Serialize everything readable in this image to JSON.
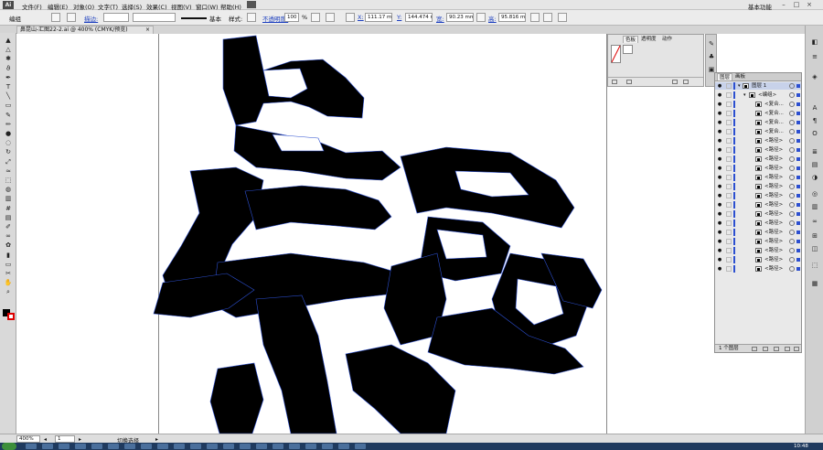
{
  "app": {
    "logo": "Ai",
    "menus": [
      "文件(F)",
      "编辑(E)",
      "对象(O)",
      "文字(T)",
      "选择(S)",
      "效果(C)",
      "视图(V)",
      "窗口(W)",
      "帮助(H)"
    ],
    "workspace": "基本功能",
    "window_buttons": [
      "–",
      "□",
      "×"
    ]
  },
  "control_bar": {
    "selection_label": "编组",
    "stroke_label": "描边:",
    "stroke_value": "",
    "brush_label": "基本",
    "style_label": "样式:",
    "opacity_label": "不透明度:",
    "opacity_value": "100",
    "opacity_unit": "%",
    "x_value": "111.17 mm",
    "y_value": "144.474 mm",
    "w_label": "宽:",
    "w_value": "90.23 mm",
    "h_label": "高:",
    "h_value": "95.816 mm"
  },
  "document": {
    "tab_title": "鼻昆山-汇图22-2.ai @ 400% (CMYK/预览)"
  },
  "tools": [
    "selection-tool",
    "direct-selection-tool",
    "magic-wand-tool",
    "lasso-tool",
    "pen-tool",
    "type-tool",
    "line-tool",
    "rectangle-tool",
    "paintbrush-tool",
    "pencil-tool",
    "blob-brush-tool",
    "eraser-tool",
    "rotate-tool",
    "scale-tool",
    "width-tool",
    "free-transform-tool",
    "shape-builder-tool",
    "perspective-grid-tool",
    "mesh-tool",
    "gradient-tool",
    "eyedropper-tool",
    "blend-tool",
    "symbol-sprayer-tool",
    "column-graph-tool",
    "artboard-tool",
    "slice-tool",
    "hand-tool",
    "zoom-tool"
  ],
  "color_panel": {
    "tabs": [
      "色板",
      "透明度",
      "动作"
    ],
    "active_tab": "色板"
  },
  "layers_panel": {
    "tabs": [
      "图层",
      "画板"
    ],
    "rows": [
      {
        "label": "图层 1",
        "level": 0
      },
      {
        "label": "<编组>",
        "level": 1
      },
      {
        "label": "<复合...",
        "level": 2
      },
      {
        "label": "<复合...",
        "level": 2
      },
      {
        "label": "<复合...",
        "level": 2
      },
      {
        "label": "<复合...",
        "level": 2
      },
      {
        "label": "<路径>",
        "level": 2
      },
      {
        "label": "<路径>",
        "level": 2
      },
      {
        "label": "<路径>",
        "level": 2
      },
      {
        "label": "<路径>",
        "level": 2
      },
      {
        "label": "<路径>",
        "level": 2
      },
      {
        "label": "<路径>",
        "level": 2
      },
      {
        "label": "<路径>",
        "level": 2
      },
      {
        "label": "<路径>",
        "level": 2
      },
      {
        "label": "<路径>",
        "level": 2
      },
      {
        "label": "<路径>",
        "level": 2
      },
      {
        "label": "<路径>",
        "level": 2
      },
      {
        "label": "<路径>",
        "level": 2
      },
      {
        "label": "<路径>",
        "level": 2
      },
      {
        "label": "<路径>",
        "level": 2
      },
      {
        "label": "<路径>",
        "level": 2
      }
    ],
    "footer": "1 个图层"
  },
  "status_bar": {
    "zoom": "400%",
    "artboard": "1",
    "state": "切换选择"
  },
  "taskbar": {
    "clock": "10:48"
  },
  "colors": {
    "accent": "#2c4fd0",
    "ink": "#000000",
    "taskbar": "#1f3a5e"
  }
}
